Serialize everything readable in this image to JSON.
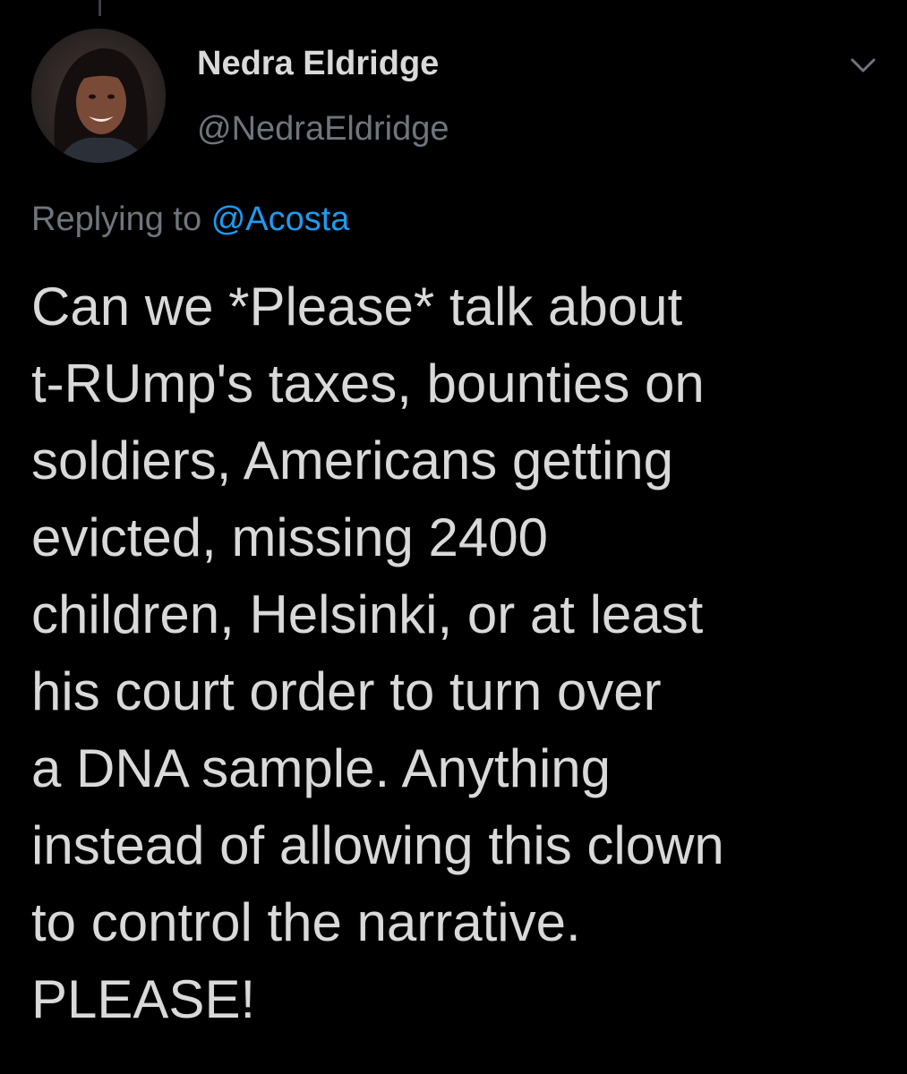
{
  "tweet": {
    "author": {
      "display_name": "Nedra Eldridge",
      "handle": "@NedraEldridge",
      "avatar_icon": "profile-photo"
    },
    "reply_prefix": "Replying to",
    "reply_to": "@Acosta",
    "text_lines": [
      "Can we *Please* talk about",
      "t-RUmp's taxes, bounties on",
      "soldiers, Americans getting",
      "evicted, missing 2400",
      "children, Helsinki, or at least",
      "his court order to turn over",
      "a DNA sample. Anything",
      "instead of allowing this clown",
      "to control the narrative.",
      "PLEASE!"
    ],
    "menu_icon": "chevron-down-icon"
  },
  "colors": {
    "background": "#000000",
    "text": "#d9d9d9",
    "muted": "#6e767d",
    "link": "#1d9bf0"
  }
}
